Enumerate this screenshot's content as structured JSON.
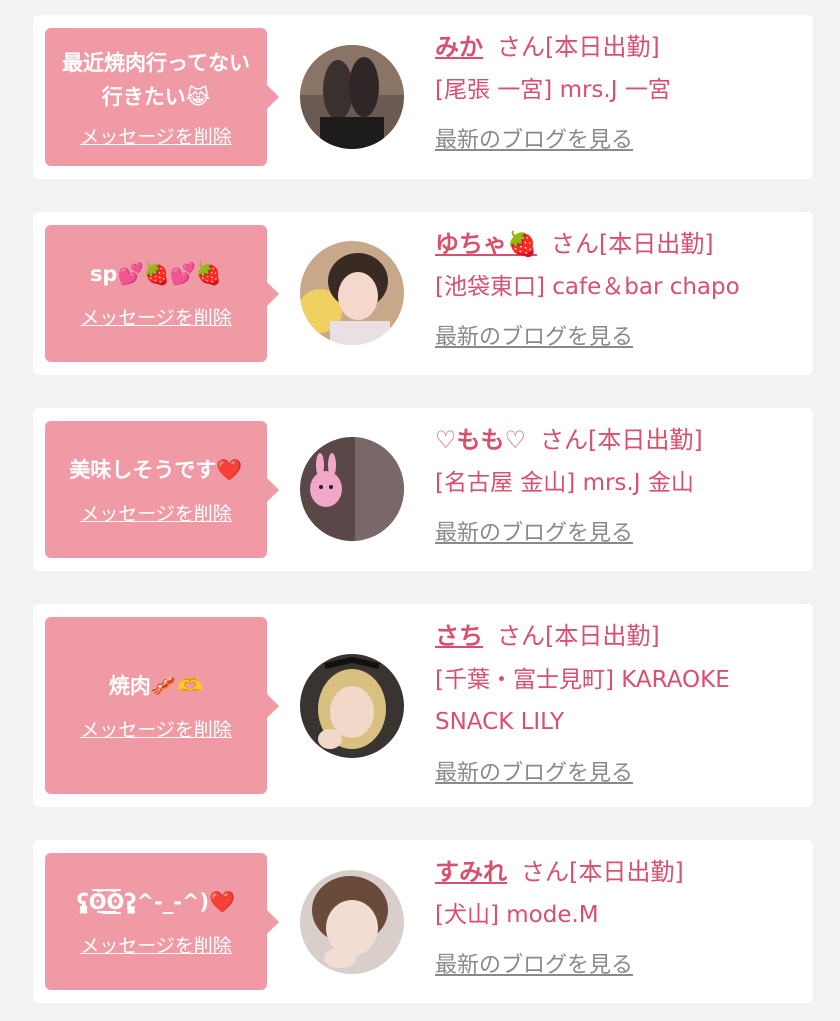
{
  "common": {
    "delete_label": "メッセージを削除",
    "blog_label": "最新のブログを見る"
  },
  "cards": [
    {
      "message": "最近焼肉行ってない行きたい😹",
      "name": "みか",
      "suffix": "さん[本日出勤]",
      "shop": "[尾張 一宮] mrs.J 一宮",
      "avatar_icon": "girl-avatar-photo"
    },
    {
      "message": "sp💕🍓💕🍓",
      "name": "ゆちゃ🍓",
      "suffix": "さん[本日出勤]",
      "shop": "[池袋東口] cafe＆bar chapo",
      "avatar_icon": "girl-avatar-photo"
    },
    {
      "message": "美味しそうです❤️",
      "name": "♡もも♡",
      "suffix": "さん[本日出勤]",
      "shop": "[名古屋 金山] mrs.J 金山",
      "avatar_icon": "girl-avatar-photo"
    },
    {
      "message": "焼肉🥓🫶",
      "name": "さち",
      "suffix": "さん[本日出勤]",
      "shop": "[千葉・富士見町] KARAOKE SNACK LILY",
      "avatar_icon": "girl-avatar-photo"
    },
    {
      "message": "ʕ̡̢̡ʘ̅͟͜͡ʘ̲̅ʔ̢̡̢^-_-^)❤️",
      "name": "すみれ",
      "suffix": "さん[本日出勤]",
      "shop": "[犬山] mode.M",
      "avatar_icon": "girl-avatar-photo"
    }
  ],
  "colors": {
    "bubble": "#ef9aa5",
    "accent": "#d9506e",
    "link_gray": "#8a8a8a",
    "background": "#f2f2f2"
  }
}
